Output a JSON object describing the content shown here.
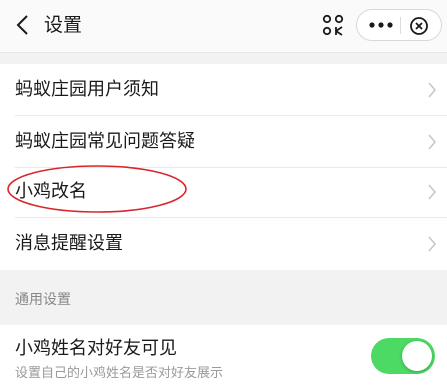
{
  "header": {
    "title": "设置",
    "icons": [
      "chevron-left-icon",
      "scan-icon",
      "more-icon",
      "close-icon"
    ]
  },
  "list": {
    "items": [
      {
        "label": "蚂蚁庄园用户须知"
      },
      {
        "label": "蚂蚁庄园常见问题答疑"
      },
      {
        "label": "小鸡改名"
      },
      {
        "label": "消息提醒设置"
      }
    ]
  },
  "general": {
    "section_title": "通用设置",
    "visibility": {
      "title": "小鸡姓名对好友可见",
      "description": "设置自己的小鸡姓名是否对好友展示",
      "enabled": true
    }
  },
  "colors": {
    "toggle_on": "#4cd964",
    "annotation": "#d9262b",
    "background": "#f2f2f2"
  }
}
